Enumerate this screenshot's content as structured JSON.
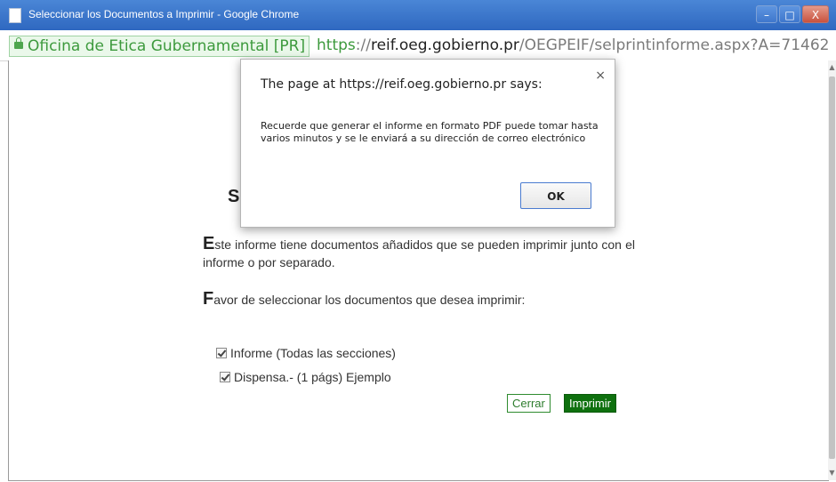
{
  "window": {
    "title": "Seleccionar los Documentos a Imprimir - Google Chrome",
    "minimize_glyph": "–",
    "maximize_glyph": "□",
    "close_glyph": "X"
  },
  "address_bar": {
    "ev_label": "Oficina de Etica Gubernamental [PR]",
    "url_scheme": "https",
    "url_sep": "://",
    "url_host": "reif.oeg.gobierno.pr",
    "url_path": "/OEGPEIF/selprintinforme.aspx?A=71462"
  },
  "page": {
    "heading_visible": "S",
    "para1_cap": "E",
    "para1_rest": "ste informe tiene documentos añadidos que se pueden imprimir junto con el informe o por separado.",
    "para2_cap": "F",
    "para2_rest": "avor de seleccionar los documentos que desea imprimir:",
    "checkboxes": [
      {
        "label": "Informe (Todas las secciones)",
        "checked": true
      },
      {
        "label": "Dispensa.- (1 págs) Ejemplo",
        "checked": true
      }
    ],
    "cerrar_label": "Cerrar",
    "imprimir_label": "Imprimir"
  },
  "dialog": {
    "title": "The page at https://reif.oeg.gobierno.pr says:",
    "message": "Recuerde que generar el informe en formato PDF puede tomar hasta varios minutos y se le enviará a su dirección de correo electrónico",
    "ok_label": "OK",
    "close_glyph": "×"
  },
  "colors": {
    "titlebar": "#3d77cb",
    "ev_green": "#3d9a3d",
    "imprimir_bg": "#0e700e"
  }
}
